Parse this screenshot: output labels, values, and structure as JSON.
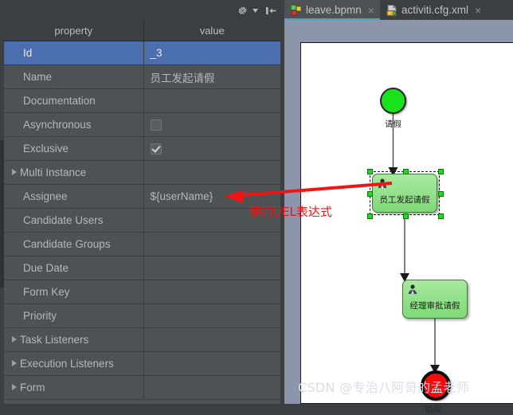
{
  "panel": {
    "toolbar": {
      "settings_icon": "gear-icon",
      "settings_dropdown_icon": "chevron-down-icon",
      "collapse_icon": "collapse-panel-icon"
    },
    "columns": [
      "property",
      "value"
    ],
    "rows": [
      {
        "name": "Id",
        "value": "_3",
        "kind": "text",
        "expandable": false,
        "selected": true
      },
      {
        "name": "Name",
        "value": "员工发起请假",
        "kind": "text",
        "expandable": false,
        "selected": false
      },
      {
        "name": "Documentation",
        "value": "",
        "kind": "text",
        "expandable": false,
        "selected": false
      },
      {
        "name": "Asynchronous",
        "value": "",
        "kind": "checkbox",
        "checked": false,
        "expandable": false,
        "selected": false
      },
      {
        "name": "Exclusive",
        "value": "",
        "kind": "checkbox",
        "checked": true,
        "expandable": false,
        "selected": false
      },
      {
        "name": "Multi Instance",
        "value": "",
        "kind": "text",
        "expandable": true,
        "selected": false
      },
      {
        "name": "Assignee",
        "value": "${userName}",
        "kind": "text",
        "expandable": false,
        "selected": false
      },
      {
        "name": "Candidate Users",
        "value": "",
        "kind": "text",
        "expandable": false,
        "selected": false
      },
      {
        "name": "Candidate Groups",
        "value": "",
        "kind": "text",
        "expandable": false,
        "selected": false
      },
      {
        "name": "Due Date",
        "value": "",
        "kind": "text",
        "expandable": false,
        "selected": false
      },
      {
        "name": "Form Key",
        "value": "",
        "kind": "text",
        "expandable": false,
        "selected": false
      },
      {
        "name": "Priority",
        "value": "",
        "kind": "text",
        "expandable": false,
        "selected": false
      },
      {
        "name": "Task Listeners",
        "value": "",
        "kind": "text",
        "expandable": true,
        "selected": false
      },
      {
        "name": "Execution Listeners",
        "value": "",
        "kind": "text",
        "expandable": true,
        "selected": false
      },
      {
        "name": "Form",
        "value": "",
        "kind": "text",
        "expandable": true,
        "selected": false
      }
    ]
  },
  "editor": {
    "tabs": [
      {
        "label": "leave.bpmn",
        "icon": "bpmn-file-icon",
        "active": true,
        "close_label": "×"
      },
      {
        "label": "activiti.cfg.xml",
        "icon": "xml-file-icon",
        "active": false,
        "close_label": "×"
      }
    ]
  },
  "diagram": {
    "start_event": {
      "label": "请假",
      "color": "#1ae21a"
    },
    "tasks": [
      {
        "label": "员工发起请假",
        "selected": true,
        "icon": "user-task-icon"
      },
      {
        "label": "经理审批请假",
        "selected": false,
        "icon": "user-task-icon"
      }
    ],
    "end_event": {
      "label": "销假",
      "color": "#f40b0b"
    }
  },
  "annotation": {
    "text": "使用UEL表达式",
    "color": "#f01414",
    "arrow_icon": "left-arrow-annotation-icon"
  },
  "watermark": {
    "text": "CSDN @专治八阿哥的孟老师"
  }
}
